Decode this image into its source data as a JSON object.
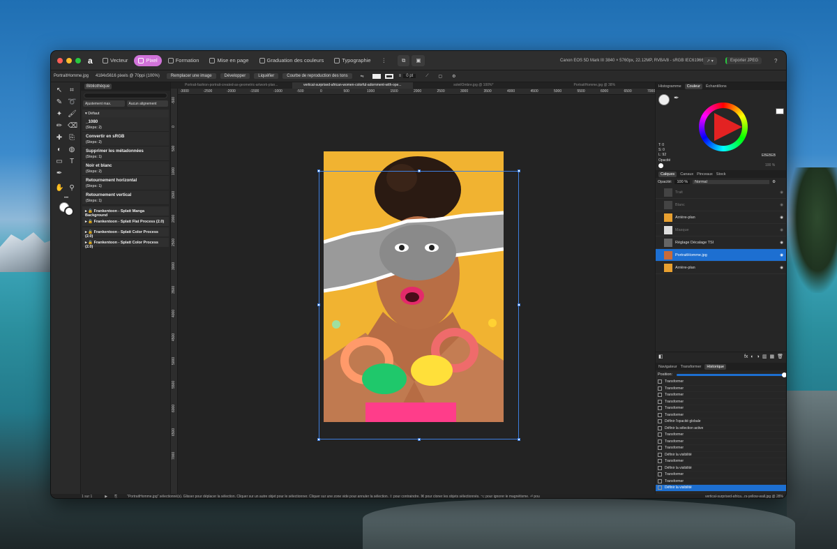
{
  "titlebar": {
    "tabs": [
      {
        "label": "Vecteur"
      },
      {
        "label": "Pixel"
      },
      {
        "label": "Formation"
      },
      {
        "label": "Mise en page"
      },
      {
        "label": "Graduation des couleurs"
      },
      {
        "label": "Typographie"
      }
    ],
    "camera": "Canon EOS 5D Mark III",
    "info": "3840 × 5760px, 22.12MP, RVBA/8 - sRGB IEC61966-2.1",
    "export": "Exporter JPEG"
  },
  "context": {
    "file": "PortraitHomme.jpg",
    "dims": "4184x5616 pixels @ 70ppi (100%)",
    "buttons": [
      "Remplacer une image",
      "Développer",
      "Liquéfier",
      "Courbe de reproduction des tons"
    ],
    "stroke": "0 pt"
  },
  "library": {
    "title": "Bibliothèque",
    "select1": "Ajustement max.",
    "select2": "Aucun alignement",
    "group": "Défaut",
    "macros": [
      {
        "name": "_1080",
        "steps": "(Steps: 2)"
      },
      {
        "name": "Convertir en sRGB",
        "steps": "(Steps: 2)"
      },
      {
        "name": "Supprimer les métadonnées",
        "steps": "(Steps: 1)"
      },
      {
        "name": "Noir et blanc",
        "steps": "(Steps: 2)"
      },
      {
        "name": "Retournement horizontal",
        "steps": "(Steps: 1)"
      },
      {
        "name": "Retournement vertical",
        "steps": "(Steps: 1)"
      }
    ],
    "categories": [
      "Frankentoon - Splatt Manga Background",
      "Frankentoon - Splatt Flat Process (2.0)",
      "Frankentoon - Splatt Color Process (2.0)",
      "Frankentoon - Splatt Color Process (2.0)"
    ]
  },
  "doctabs": [
    "Portrait-fashion-portrait-created-as-geometric-artwork-plan...",
    "vertical-surprised-african-women-colorful-adornment-with-ope...",
    "soleilOmbre.jpg @ 100%*",
    "PortraitHomme.jpg @ 38%"
  ],
  "ruler": {
    "h": [
      "-3000",
      "-2500",
      "-2000",
      "-1500",
      "-1000",
      "-500",
      "0",
      "500",
      "1000",
      "1500",
      "2000",
      "2500",
      "3000",
      "3500",
      "4000",
      "4500",
      "5000",
      "5500",
      "6000",
      "6500",
      "7000"
    ],
    "v": [
      "-500",
      "0",
      "500",
      "1000",
      "1500",
      "2000",
      "2500",
      "3000",
      "3500",
      "4000",
      "4500",
      "5000",
      "5500",
      "6000",
      "6500",
      "7000"
    ]
  },
  "color": {
    "tabs": [
      "Histogramme",
      "Couleur",
      "Échantillons"
    ],
    "tval": "T: 0",
    "sval": "S: 0",
    "lval": "L: 92",
    "opacity": "Opacité",
    "hex": "EBEBEB",
    "zoom": "100 %"
  },
  "layers": {
    "tabs": [
      "Calques",
      "Canaux",
      "Pinceaux",
      "Stock"
    ],
    "opacity_label": "Opacité:",
    "opacity": "100 %",
    "blend": "Normal",
    "items": [
      {
        "name": "Trait",
        "dim": true
      },
      {
        "name": "Blanc",
        "dim": true
      },
      {
        "name": "Arrière-plan"
      },
      {
        "name": "Masque",
        "dim": true
      },
      {
        "name": "Réglage Décalage TSI"
      },
      {
        "name": "PortraitHomme.jpg"
      },
      {
        "name": "Arrière-plan"
      }
    ]
  },
  "history": {
    "tabs": [
      "Navigateur",
      "Transformer",
      "Historique"
    ],
    "position": "Position:",
    "items": [
      "Transformer",
      "Transformer",
      "Transformer",
      "Transformer",
      "Transformer",
      "Transformer",
      "Définir l'opacité globale",
      "Définir la sélection active",
      "Transformer",
      "Transformer",
      "Transformer",
      "Définir la visibilité",
      "Transformer",
      "Définir la visibilité",
      "Transformer",
      "Transformer",
      "Définir la visibilité"
    ]
  },
  "status": {
    "page": "1 sur 1",
    "text": "\"PortraitHomme.jpg\" sélectionné(s). Glisser pour déplacer la sélection. Cliquer sur un autre objet pour le sélectionner. Cliquer sur une zone vide pour annuler la sélection. ⇧ pour contraindre. ⌘ pour cloner les objets sélectionnés. ⌥ pour ignorer le magnétisme. ⏎ pour sélectionner/dupliquer des valeurs.",
    "doc": "vertical-surprised-africa...rs-yellow-wall.jpg @ 28%"
  },
  "colors": {
    "accent": "#1d6fd1",
    "pixel_tab": "#d173d9",
    "selection": "#3e7fe0",
    "background_yellow": "#f1b331"
  }
}
